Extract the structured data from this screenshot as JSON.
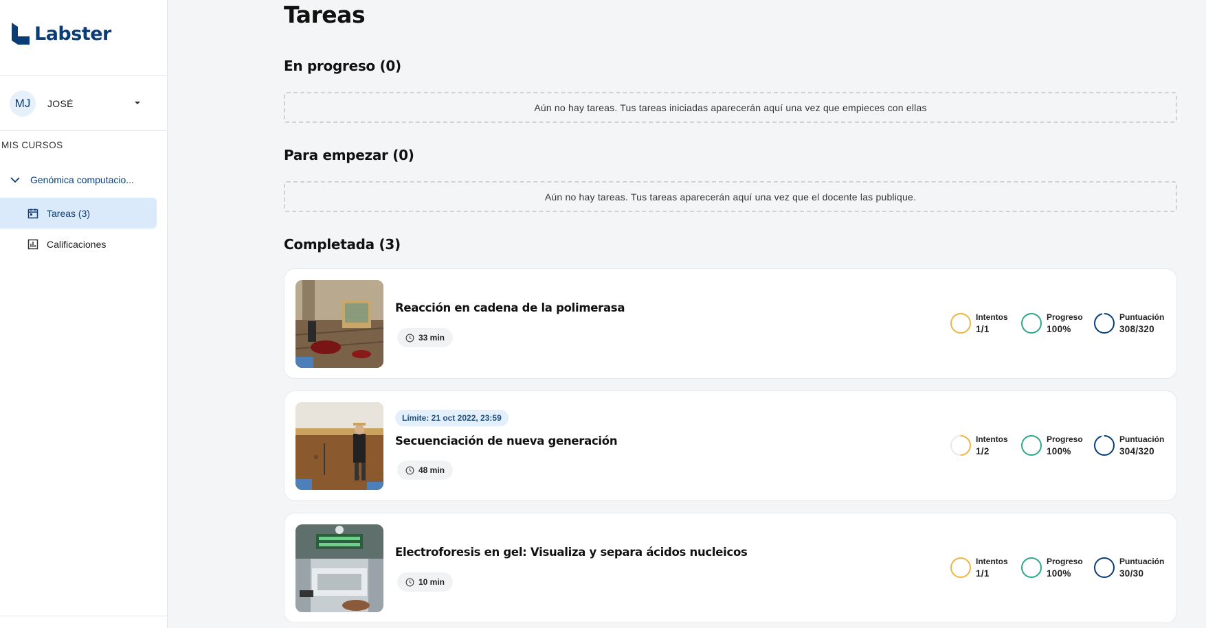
{
  "brand": {
    "name": "Labster"
  },
  "user": {
    "initials": "MJ",
    "name": "JOSÉ"
  },
  "sidebar": {
    "section_label": "MIS CURSOS",
    "course_name": "Genómica computacio...",
    "items": [
      {
        "label": "Tareas (3)",
        "icon": "calendar-icon",
        "active": true
      },
      {
        "label": "Calificaciones",
        "icon": "bar-chart-icon",
        "active": false
      }
    ]
  },
  "main": {
    "title": "Tareas",
    "in_progress": {
      "heading": "En progreso (0)",
      "empty": "Aún no hay tareas. Tus tareas iniciadas aparecerán aquí una vez que empieces con ellas"
    },
    "to_start": {
      "heading": "Para empezar (0)",
      "empty": "Aún no hay tareas. Tus tareas aparecerán aquí una vez que el docente las publique."
    },
    "completed": {
      "heading": "Completada (3)",
      "cards": [
        {
          "title": "Reacción en cadena de la polimerasa",
          "deadline": "",
          "duration": "33 min",
          "attempts_label": "Intentos",
          "attempts": "1/1",
          "attempts_fraction": 1.0,
          "progress_label": "Progreso",
          "progress": "100%",
          "progress_fraction": 1.0,
          "score_label": "Puntuación",
          "score": "308/320",
          "score_fraction": 0.9625
        },
        {
          "title": "Secuenciación de nueva generación",
          "deadline": "Límite: 21 oct 2022, 23:59",
          "duration": "48 min",
          "attempts_label": "Intentos",
          "attempts": "1/2",
          "attempts_fraction": 0.5,
          "progress_label": "Progreso",
          "progress": "100%",
          "progress_fraction": 1.0,
          "score_label": "Puntuación",
          "score": "304/320",
          "score_fraction": 0.95
        },
        {
          "title": "Electroforesis en gel: Visualiza y separa ácidos nucleicos",
          "deadline": "",
          "duration": "10 min",
          "attempts_label": "Intentos",
          "attempts": "1/1",
          "attempts_fraction": 1.0,
          "progress_label": "Progreso",
          "progress": "100%",
          "progress_fraction": 1.0,
          "score_label": "Puntuación",
          "score": "30/30",
          "score_fraction": 1.0
        }
      ]
    }
  },
  "colors": {
    "brand": "#0a3d76",
    "attempts": "#f2b640",
    "progress": "#2fa889",
    "score": "#0a3d76",
    "active_bg": "#dbeafa"
  }
}
